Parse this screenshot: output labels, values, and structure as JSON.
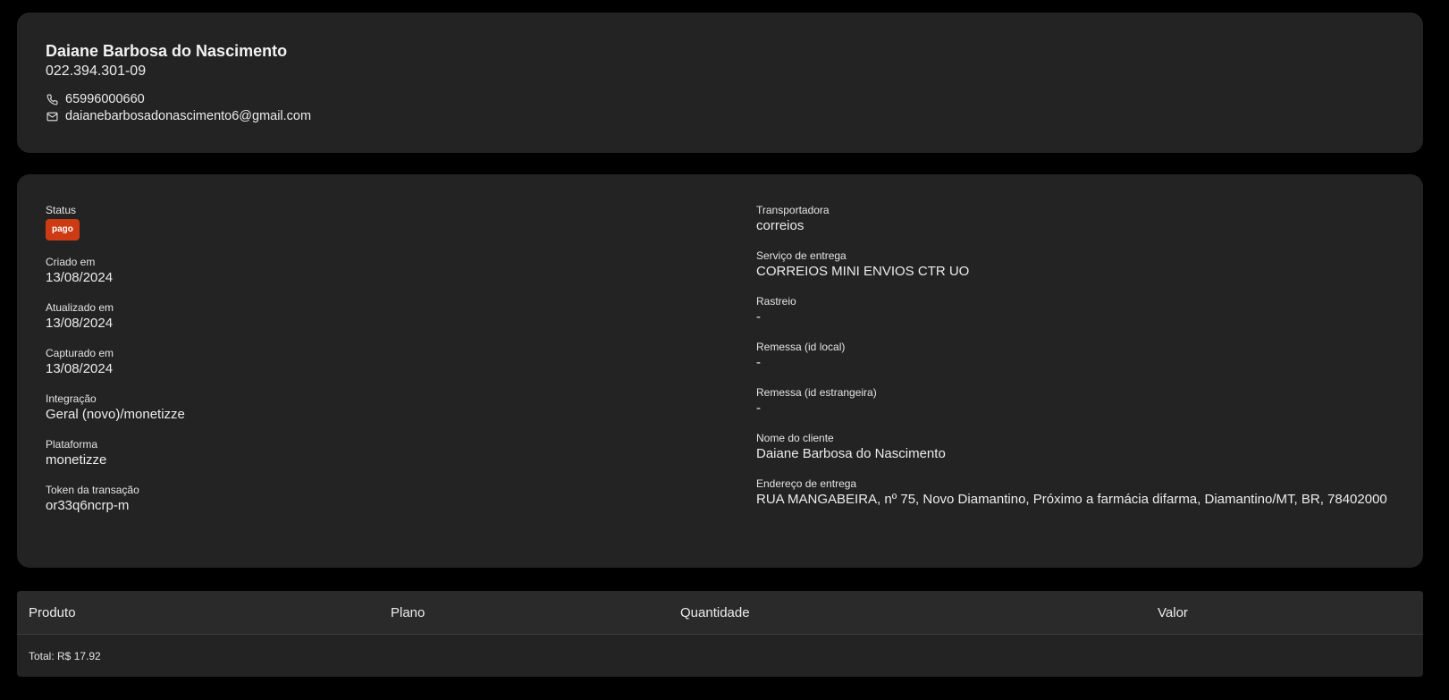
{
  "customer": {
    "name": "Daiane Barbosa do Nascimento",
    "document": "022.394.301-09",
    "phone": "65996000660",
    "email": "daianebarbosadonascimento6@gmail.com",
    "phone_icon": "phone-icon",
    "email_icon": "mail-icon"
  },
  "details": {
    "status": {
      "label": "Status",
      "value": "pago",
      "color": "#cc3b14"
    },
    "created": {
      "label": "Criado em",
      "value": "13/08/2024"
    },
    "updated": {
      "label": "Atualizado em",
      "value": "13/08/2024"
    },
    "captured": {
      "label": "Capturado em",
      "value": "13/08/2024"
    },
    "integration": {
      "label": "Integração",
      "value": "Geral (novo)/monetizze"
    },
    "platform": {
      "label": "Plataforma",
      "value": "monetizze"
    },
    "token": {
      "label": "Token da transação",
      "value": "or33q6ncrp-m"
    },
    "carrier": {
      "label": "Transportadora",
      "value": "correios"
    },
    "delivery_service": {
      "label": "Serviço de entrega",
      "value": "CORREIOS MINI ENVIOS CTR UO"
    },
    "tracking": {
      "label": "Rastreio",
      "value": "-"
    },
    "shipment_local": {
      "label": "Remessa (id local)",
      "value": "-"
    },
    "shipment_foreign": {
      "label": "Remessa (id estrangeira)",
      "value": "-"
    },
    "client_name": {
      "label": "Nome do cliente",
      "value": "Daiane Barbosa do Nascimento"
    },
    "delivery_address": {
      "label": "Endereço de entrega",
      "value": "RUA MANGABEIRA, nº 75, Novo Diamantino, Próximo a farmácia difarma, Diamantino/MT, BR, 78402000"
    }
  },
  "products_table": {
    "columns": [
      "Produto",
      "Plano",
      "Quantidade",
      "Valor"
    ],
    "rows": [],
    "total": "Total: R$ 17.92"
  }
}
